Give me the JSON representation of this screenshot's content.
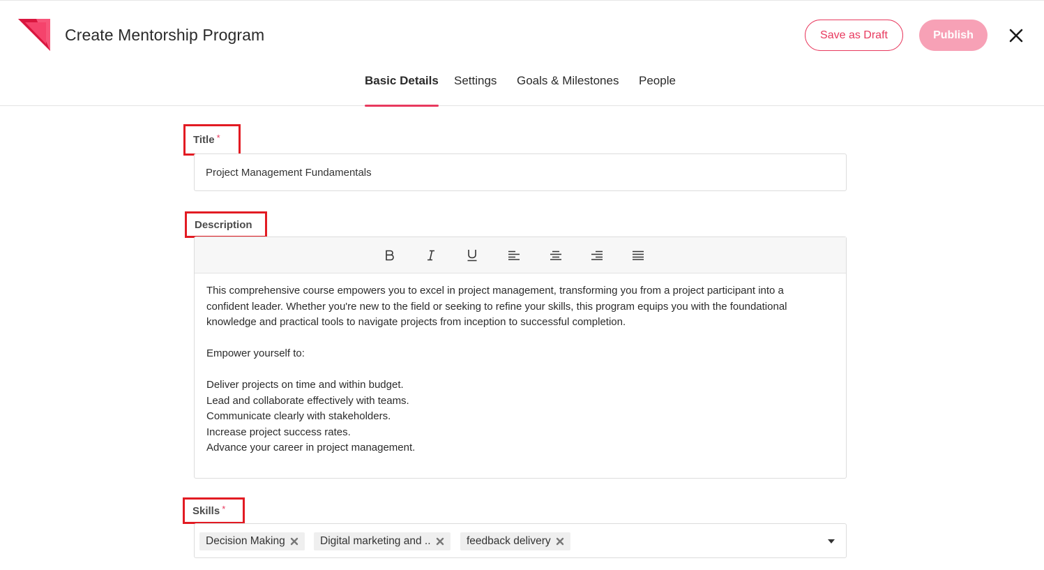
{
  "header": {
    "title": "Create Mentorship Program",
    "save_draft_label": "Save as Draft",
    "publish_label": "Publish",
    "close_icon": "close-icon",
    "logo_icon": "brand-logo-icon",
    "brand_color": "#e8395e"
  },
  "tabs": [
    {
      "label": "Basic Details",
      "active": true
    },
    {
      "label": "Settings",
      "active": false
    },
    {
      "label": "Goals & Milestones",
      "active": false
    },
    {
      "label": "People",
      "active": false
    }
  ],
  "form": {
    "title": {
      "label": "Title",
      "required_mark": "*",
      "value": "Project Management Fundamentals"
    },
    "description": {
      "label": "Description",
      "toolbar": [
        "bold-icon",
        "italic-icon",
        "underline-icon",
        "align-left-icon",
        "align-center-icon",
        "align-right-icon",
        "align-justify-icon"
      ],
      "lines": [
        "This comprehensive course empowers you to excel in project management, transforming you from a project participant into a",
        "confident leader. Whether you're new to the field or seeking to refine your skills, this program equips you with the foundational",
        "knowledge and practical tools to navigate projects from inception to successful completion.",
        "",
        "Empower yourself to:",
        "",
        "Deliver projects on time and within budget.",
        "Lead and collaborate effectively with teams.",
        "Communicate clearly with stakeholders.",
        "Increase project success rates.",
        "Advance your career in project management."
      ]
    },
    "skills": {
      "label": "Skills",
      "required_mark": "*",
      "chips": [
        "Decision Making",
        "Digital marketing and ..",
        "feedback delivery"
      ]
    }
  }
}
